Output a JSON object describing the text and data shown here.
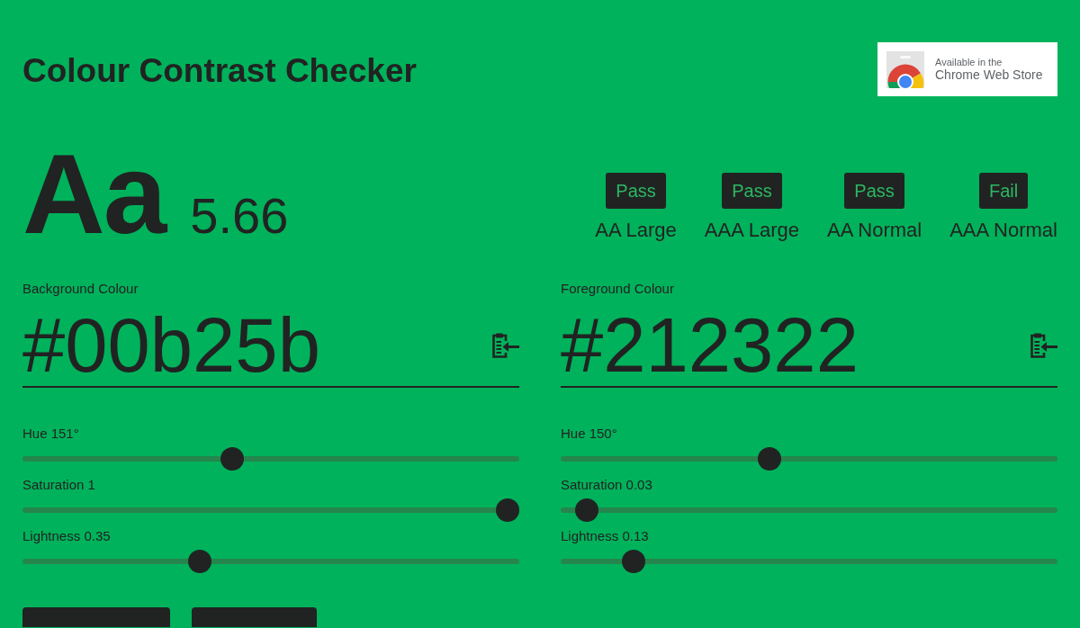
{
  "header": {
    "title": "Colour Contrast Checker",
    "store_link": {
      "line_1": "Available in the",
      "line_2": "Chrome Web Store"
    }
  },
  "preview": {
    "sample": "Aa",
    "ratio": "5.66"
  },
  "results": [
    {
      "result": "Pass",
      "label": "AA Large"
    },
    {
      "result": "Pass",
      "label": "AAA Large"
    },
    {
      "result": "Pass",
      "label": "AA Normal"
    },
    {
      "result": "Fail",
      "label": "AAA Normal"
    }
  ],
  "colours": [
    {
      "label": "Background Colour",
      "value": "#00b25b",
      "sliders": [
        {
          "label": "Hue 151°",
          "level": 0.419
        },
        {
          "label": "Saturation 1",
          "level": 1
        },
        {
          "label": "Lightness 0.35",
          "level": 0.35
        }
      ]
    },
    {
      "label": "Foreground Colour",
      "value": "#212322",
      "sliders": [
        {
          "label": "Hue 150°",
          "level": 0.417
        },
        {
          "label": "Saturation 0.03",
          "level": 0.03
        },
        {
          "label": "Lightness 0.13",
          "level": 0.13
        }
      ]
    }
  ],
  "buttons": [
    {
      "kind": "button"
    },
    {
      "kind": "button"
    }
  ]
}
